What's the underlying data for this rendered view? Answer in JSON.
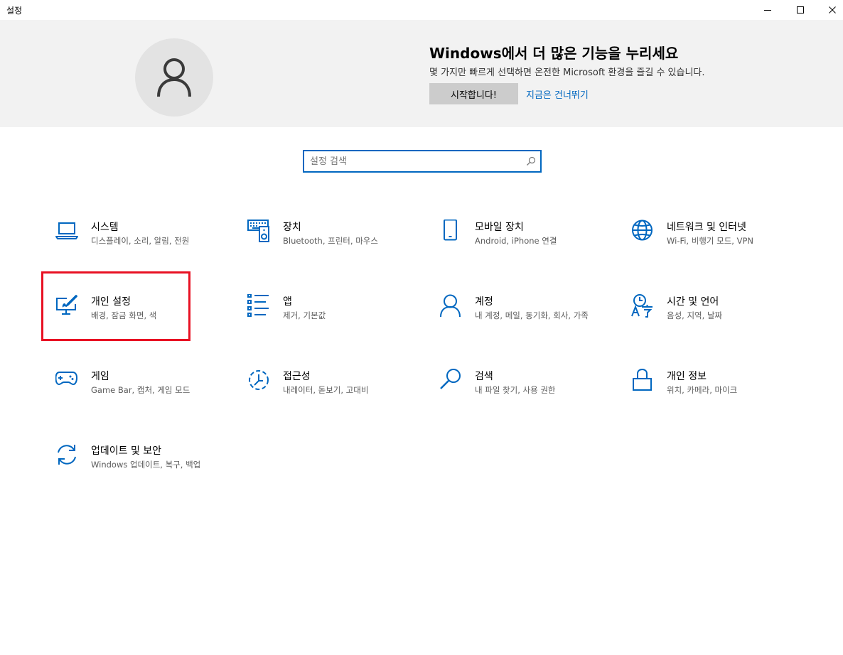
{
  "window": {
    "title": "설정",
    "controls": {
      "minimize": "minimize-icon",
      "maximize": "maximize-icon",
      "close": "close-icon"
    }
  },
  "banner": {
    "avatar_icon": "user-icon",
    "title": "Windows에서 더 많은 기능을 누리세요",
    "subtitle": "몇 가지만 빠르게 선택하면 온전한 Microsoft 환경을 즐길 수 있습니다.",
    "start_label": "시작합니다!",
    "skip_label": "지금은 건너뛰기"
  },
  "search": {
    "placeholder": "설정 검색",
    "value": ""
  },
  "colors": {
    "accent": "#0067c0",
    "highlight": "#e81123",
    "banner_bg": "#f2f2f2"
  },
  "categories": [
    {
      "name": "시스템",
      "desc": "디스플레이, 소리, 알림, 전원",
      "icon": "laptop-icon"
    },
    {
      "name": "장치",
      "desc": "Bluetooth, 프린터, 마우스",
      "icon": "devices-icon"
    },
    {
      "name": "모바일 장치",
      "desc": "Android, iPhone 연결",
      "icon": "phone-icon"
    },
    {
      "name": "네트워크 및 인터넷",
      "desc": "Wi-Fi, 비행기 모드, VPN",
      "icon": "globe-icon"
    },
    {
      "name": "개인 설정",
      "desc": "배경, 잠금 화면, 색",
      "icon": "personalization-icon"
    },
    {
      "name": "앱",
      "desc": "제거, 기본값",
      "icon": "apps-list-icon"
    },
    {
      "name": "계정",
      "desc": "내 계정, 메일, 동기화, 회사, 가족",
      "icon": "account-icon"
    },
    {
      "name": "시간 및 언어",
      "desc": "음성, 지역, 날짜",
      "icon": "time-language-icon"
    },
    {
      "name": "게임",
      "desc": "Game Bar, 캡처, 게임 모드",
      "icon": "gamepad-icon"
    },
    {
      "name": "접근성",
      "desc": "내레이터, 돋보기, 고대비",
      "icon": "accessibility-icon"
    },
    {
      "name": "검색",
      "desc": "내 파일 찾기, 사용 권한",
      "icon": "search-icon"
    },
    {
      "name": "개인 정보",
      "desc": "위치, 카메라, 마이크",
      "icon": "lock-icon"
    },
    {
      "name": "업데이트 및 보안",
      "desc": "Windows 업데이트, 복구, 백업",
      "icon": "update-icon"
    }
  ]
}
